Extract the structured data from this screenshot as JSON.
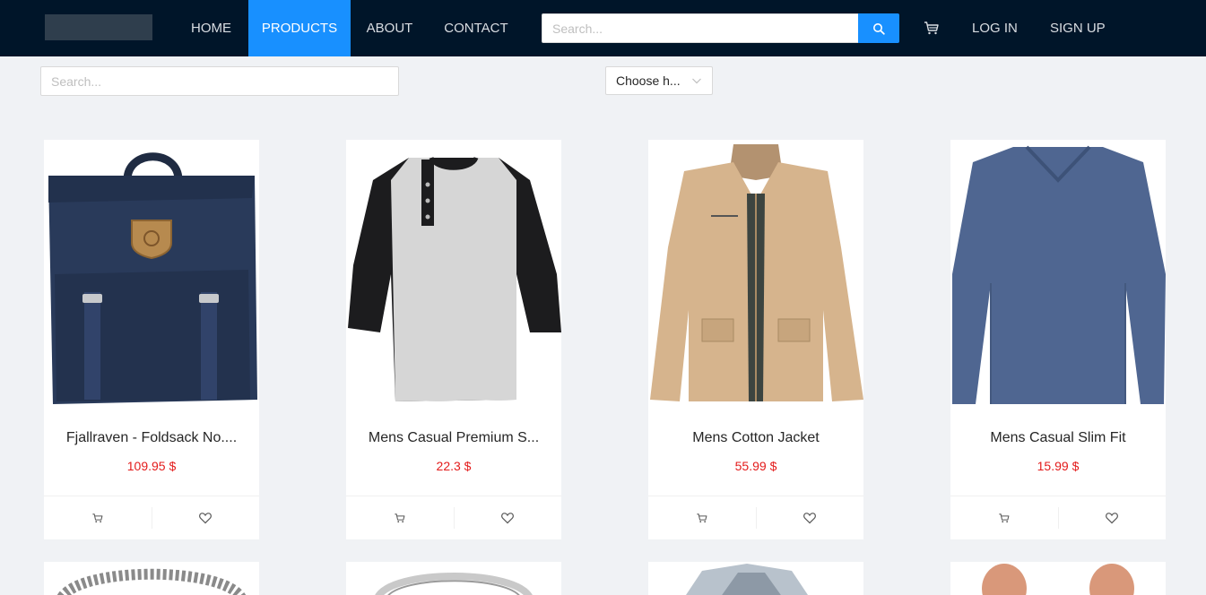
{
  "header": {
    "nav": [
      {
        "label": "HOME",
        "active": false
      },
      {
        "label": "PRODUCTS",
        "active": true
      },
      {
        "label": "ABOUT",
        "active": false
      },
      {
        "label": "CONTACT",
        "active": false
      }
    ],
    "search_placeholder": "Search...",
    "search_icon": "search-icon",
    "cart_icon": "shopping-cart-icon",
    "login_label": "LOG IN",
    "signup_label": "SIGN UP"
  },
  "filters": {
    "search_placeholder": "Search...",
    "sort_select_label": "Choose h..."
  },
  "products": [
    {
      "title": "Fjallraven - Foldsack No....",
      "price": "109.95 $",
      "image": "backpack"
    },
    {
      "title": "Mens Casual Premium S...",
      "price": "22.3 $",
      "image": "raglan-shirt"
    },
    {
      "title": "Mens Cotton Jacket",
      "price": "55.99 $",
      "image": "cotton-jacket"
    },
    {
      "title": "Mens Casual Slim Fit",
      "price": "15.99 $",
      "image": "slim-fit-tee"
    }
  ],
  "more_products": [
    {
      "image": "bracelet"
    },
    {
      "image": "ring"
    },
    {
      "image": "diamond-ring"
    },
    {
      "image": "earrings"
    }
  ],
  "colors": {
    "header_bg": "#001529",
    "accent": "#1890ff",
    "price": "#e31b1b",
    "page_bg": "#f0f2f5"
  }
}
